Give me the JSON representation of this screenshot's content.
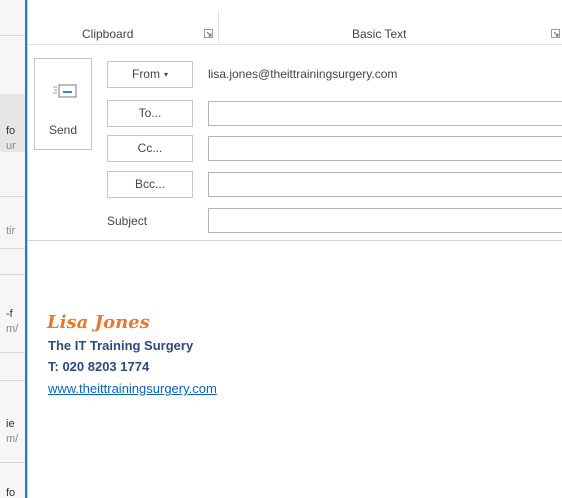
{
  "background_list": {
    "fragments": [
      {
        "text": "fo",
        "style": "main"
      },
      {
        "text": "ur",
        "style": "sub"
      },
      {
        "text": "tir",
        "style": "sub"
      },
      {
        "text": "-f",
        "style": "main"
      },
      {
        "text": "m/",
        "style": "sub"
      },
      {
        "text": "ie",
        "style": "main"
      },
      {
        "text": "m/",
        "style": "sub"
      },
      {
        "text": "fo",
        "style": "main"
      }
    ]
  },
  "ribbon": {
    "groups": [
      {
        "label": "Clipboard"
      },
      {
        "label": "Basic Text"
      }
    ]
  },
  "compose": {
    "send_label": "Send",
    "from_label": "From",
    "from_chevron": "▾",
    "from_value": "lisa.jones@theittrainingsurgery.com",
    "to_label": "To...",
    "cc_label": "Cc...",
    "bcc_label": "Bcc...",
    "subject_label": "Subject"
  },
  "message": {
    "signature": {
      "name": "Lisa Jones",
      "company": "The IT Training Surgery",
      "phone": "T: 020 8203 1774",
      "website": "www.theittrainingsurgery.com"
    }
  },
  "colors": {
    "accent": "#2b79c2",
    "signature_name": "#e8792a",
    "signature_text": "#2a4a80",
    "link": "#0563c1"
  },
  "icons": {
    "send": "send-envelope-icon",
    "launcher": "dialog-launcher-icon"
  }
}
